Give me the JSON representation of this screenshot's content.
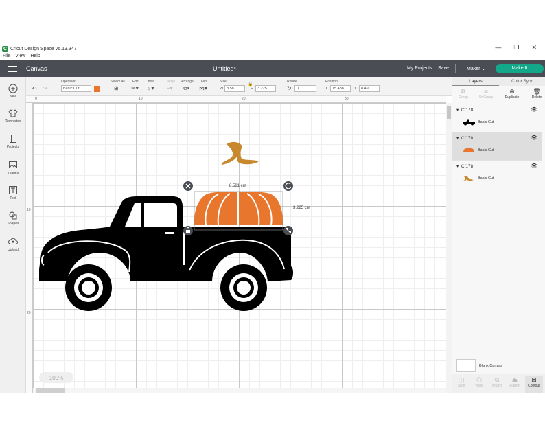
{
  "app": {
    "name": "Cricut Design Space",
    "version": "v6.13.347",
    "menu": [
      "File",
      "View",
      "Help"
    ],
    "win_min": "—",
    "win_max": "❐",
    "win_close": "✕"
  },
  "header": {
    "section": "Canvas",
    "project_title": "Untitled*",
    "my_projects": "My Projects",
    "save": "Save",
    "machine": "Maker",
    "make_it": "Make It"
  },
  "load_progress": 0.2,
  "toolbar": {
    "operation_label": "Operation",
    "operation_value": "Basic Cut",
    "operation_color": "#e8772d",
    "select_all": "Select All",
    "edit": "Edit",
    "offset": "Offset",
    "align": "Align",
    "arrange": "Arrange",
    "flip": "Flip",
    "size_label": "Size",
    "w_label": "W",
    "w_value": "8.581",
    "h_label": "H",
    "h_value": "3.225",
    "rotate_label": "Rotate",
    "rotate_value": "0",
    "position_label": "Position",
    "x_label": "X",
    "x_value": "15.438",
    "y_label": "Y",
    "y_value": "8.49"
  },
  "leftbar": [
    {
      "label": "New",
      "icon": "plus-icon"
    },
    {
      "label": "Templates",
      "icon": "tshirt-icon"
    },
    {
      "label": "Projects",
      "icon": "projects-icon"
    },
    {
      "label": "Images",
      "icon": "image-icon"
    },
    {
      "label": "Text",
      "icon": "text-icon"
    },
    {
      "label": "Shapes",
      "icon": "shapes-icon"
    },
    {
      "label": "Upload",
      "icon": "upload-icon"
    }
  ],
  "ruler": {
    "top": [
      "0",
      "10",
      "20",
      "30"
    ],
    "left": [
      "10",
      "20"
    ]
  },
  "canvas": {
    "width_readout": "8.581 cm",
    "height_readout": "3.225 cm",
    "zoom": "100%",
    "pumpkin_color": "#e8772d",
    "stem_color": "#c8892e",
    "truck_color": "#000000"
  },
  "layers_panel": {
    "tabs": [
      "Layers",
      "Color Sync"
    ],
    "actions": [
      "Group",
      "UnGroup",
      "Duplicate",
      "Delete"
    ],
    "groups": [
      {
        "name": "Cf178",
        "layer": "Basic Cut",
        "thumb": "truck"
      },
      {
        "name": "Cf178",
        "layer": "Basic Cut",
        "thumb": "pumpkin"
      },
      {
        "name": "Cf178",
        "layer": "Basic Cut",
        "thumb": "stem"
      }
    ],
    "blank_canvas": "Blank Canvas",
    "bottom_tools": [
      "Slice",
      "Weld",
      "Attach",
      "Flatten",
      "Contour"
    ]
  }
}
